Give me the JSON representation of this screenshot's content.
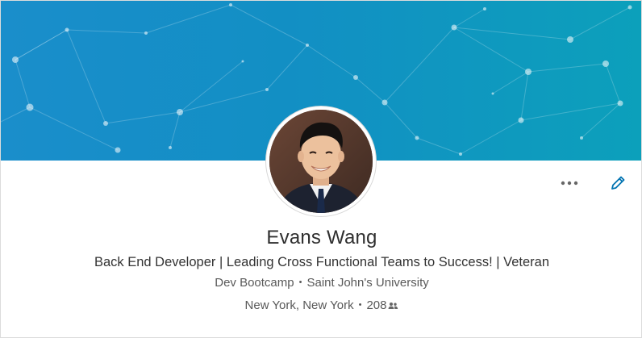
{
  "profile": {
    "name": "Evans Wang",
    "headline": "Back End Developer | Leading Cross Functional Teams to Success! | Veteran",
    "education": [
      "Dev Bootcamp",
      "Saint John's University"
    ],
    "location": "New York, New York",
    "connections": "208"
  },
  "actions": {
    "more": "···"
  },
  "icons": {
    "more": "more-horizontal-icon",
    "edit": "pencil-icon",
    "connections": "people-icon"
  },
  "colors": {
    "banner_start": "#1a8ecb",
    "banner_end": "#0ca0bb",
    "edit_icon": "#0073b1",
    "more_icon": "#666666"
  }
}
